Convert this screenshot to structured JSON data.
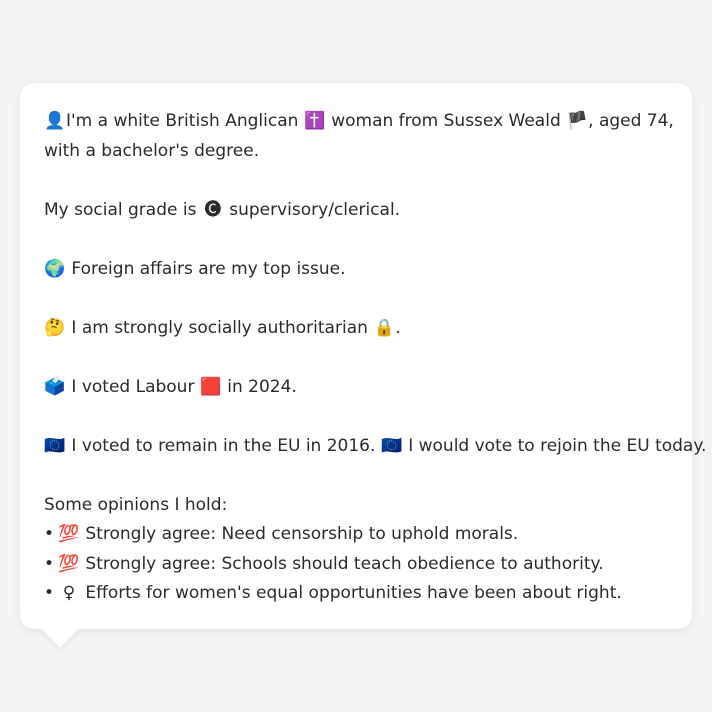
{
  "profile": {
    "line1a": {
      "icon": "👤",
      "text": "I'm a white British Anglican "
    },
    "line1b": {
      "icon": "✝️",
      "text": " woman from Sussex Weald "
    },
    "line1c": {
      "icon": "🏴",
      "text": ", aged 74,"
    },
    "line2": "with a bachelor's degree.",
    "social_grade": {
      "prefix": "My social grade is ",
      "icon": "🅒",
      "text": " supervisory/clerical."
    },
    "top_issue": {
      "icon": "🌍",
      "text": " Foreign affairs are my top issue."
    },
    "social_view": {
      "icon": "🤔",
      "text": " I am strongly socially authoritarian ",
      "icon2": "🔒",
      "suffix": "."
    },
    "vote_2024": {
      "icon": "🗳️",
      "text": " I voted Labour ",
      "icon2": "🟥",
      "suffix": " in 2024."
    },
    "eu": {
      "icon": "🇪🇺",
      "text": " I voted to remain in the EU in 2016. ",
      "icon2": "🇪🇺",
      "suffix": " I would vote to rejoin the EU today."
    }
  },
  "opinions": {
    "heading": "Some opinions I hold:",
    "items": [
      {
        "bullet": "•",
        "icon": "💯",
        "text": " Strongly agree: Need censorship to uphold morals."
      },
      {
        "bullet": "•",
        "icon": "💯",
        "text": " Strongly agree: Schools should teach obedience to authority."
      },
      {
        "bullet": "•",
        "icon": "♀",
        "text": " Efforts for women's equal opportunities have been about right."
      }
    ]
  }
}
